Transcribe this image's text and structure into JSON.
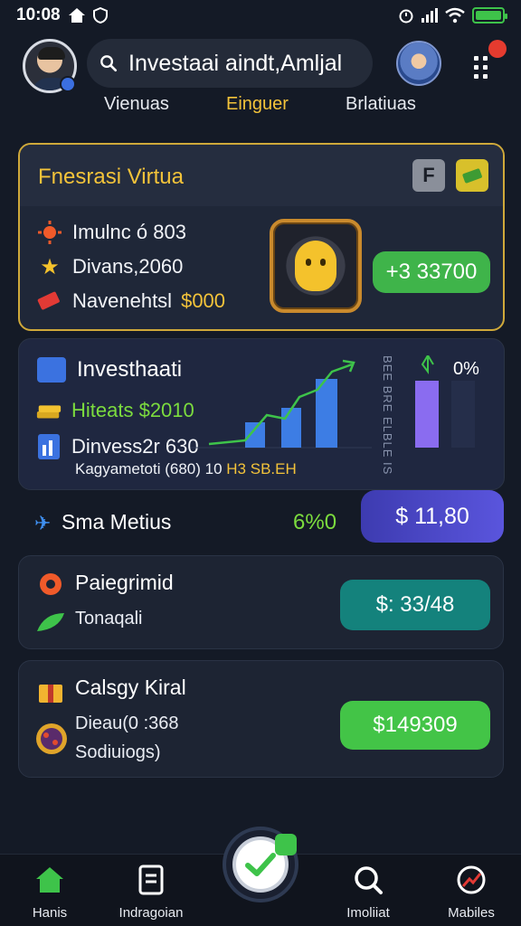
{
  "status_bar": {
    "time": "10:08"
  },
  "header": {
    "search_value": "Investaai aindt,Amljal",
    "search_icon": "search-icon",
    "menu_icon": "grid-menu-icon"
  },
  "tabs": [
    {
      "label": "Vienuas",
      "active": false
    },
    {
      "label": "Einguer",
      "active": true
    },
    {
      "label": "Brlatiuas",
      "active": false
    }
  ],
  "featured": {
    "title": "Fnesrasi Virtua",
    "chip1": "F",
    "stats": [
      {
        "icon": "sun-icon",
        "text": "Imulnc ó 803"
      },
      {
        "icon": "star-icon",
        "text": "Divans,2060"
      },
      {
        "icon": "ticket-icon",
        "text": "Navenehtsl",
        "highlight": "$000"
      }
    ],
    "action_label": "+3 33700"
  },
  "invest": {
    "title": "Investhaati",
    "rows": [
      {
        "icon": "coins-icon",
        "text": "Hiteats $2010"
      },
      {
        "icon": "chart-doc-icon",
        "text": "Dinvess2r 630"
      }
    ],
    "small_line": "Kagyametoti (680) 10",
    "small_highlight": "H3 SB.EH",
    "side_text": "BEE BRE ELBLE IS",
    "percent": "0%",
    "colors": {
      "bar_blue": "#3d7de4",
      "bar_purple": "#8a6cf0",
      "line_green": "#3ec34a"
    }
  },
  "summary": {
    "title": "Sma Metius",
    "value": "6%0",
    "badge": "$ 11,80"
  },
  "list": [
    {
      "title": "Paiegrimid",
      "sub": "Tonaqali",
      "button": "$: 33/48",
      "button_color": "#14827c"
    },
    {
      "title": "Calsgy Kiral",
      "sub": "Dieau(0 :368",
      "sub2": "Sodiuiogs)",
      "button": "$149309",
      "button_color": "#43c447"
    }
  ],
  "bottom_nav": [
    {
      "label": "Hanis",
      "icon": "home-icon"
    },
    {
      "label": "Indragoian",
      "icon": "document-icon"
    },
    {
      "label": "Imoliiat",
      "icon": "search-icon"
    },
    {
      "label": "Mabiles",
      "icon": "chart-circle-icon"
    }
  ]
}
